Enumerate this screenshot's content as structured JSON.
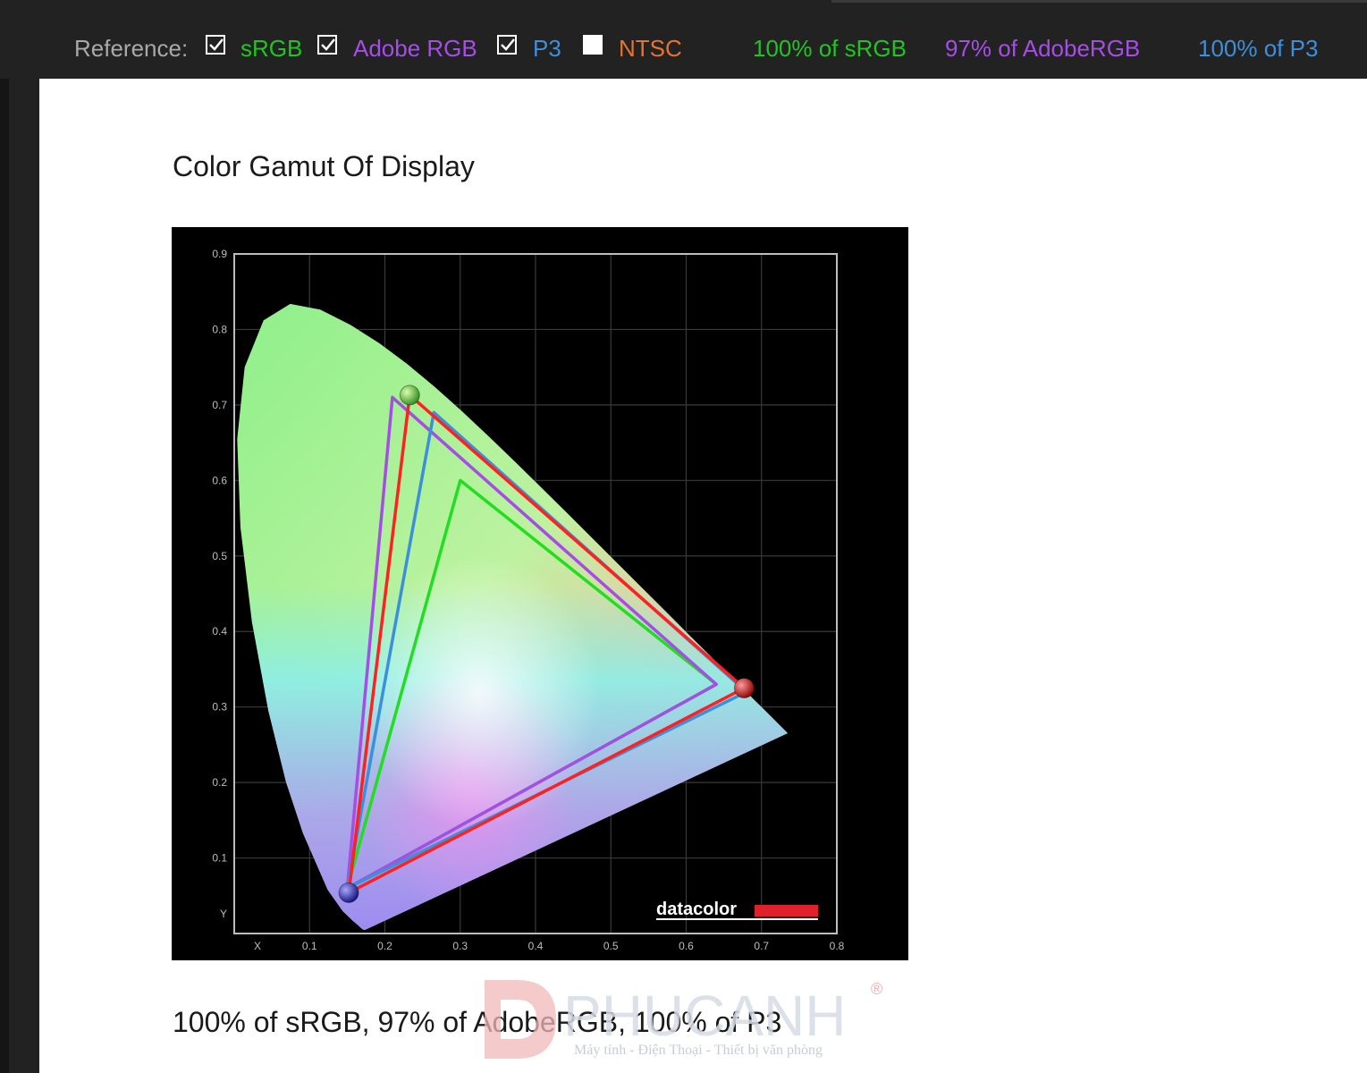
{
  "toolbar": {
    "reference_label": "Reference:",
    "options": [
      {
        "label": "sRGB",
        "checked": true,
        "color": "#22c322"
      },
      {
        "label": "Adobe RGB",
        "checked": true,
        "color": "#a64de6"
      },
      {
        "label": "P3",
        "checked": true,
        "color": "#3d8fdc"
      },
      {
        "label": "NTSC",
        "checked": false,
        "color": "#e8742c"
      }
    ],
    "results": [
      {
        "text": "100% of sRGB",
        "color": "#22c322"
      },
      {
        "text": "97% of AdobeRGB",
        "color": "#a64de6"
      },
      {
        "text": "100% of P3",
        "color": "#3d8fdc"
      }
    ]
  },
  "main": {
    "title": "Color Gamut Of Display",
    "caption": "100% of sRGB, 97% of AdobeRGB, 100% of P3"
  },
  "watermark": {
    "brand": "PHUCANH",
    "tagline": "Máy tính - Điện Thoại - Thiết bị văn phòng",
    "registered": "®"
  },
  "chart_data": {
    "type": "scatter",
    "title": "",
    "xlabel": "X",
    "ylabel": "Y",
    "xlim": [
      0.0,
      0.8
    ],
    "ylim": [
      0.0,
      0.9
    ],
    "x_ticks": [
      "0.1",
      "0.2",
      "0.3",
      "0.4",
      "0.5",
      "0.6",
      "0.7",
      "0.8"
    ],
    "y_ticks": [
      "0.1",
      "0.2",
      "0.3",
      "0.4",
      "0.5",
      "0.6",
      "0.7",
      "0.8",
      "0.9"
    ],
    "grid": true,
    "brand": "datacolor",
    "series": [
      {
        "name": "sRGB",
        "color": "#22dd22",
        "points": [
          [
            0.64,
            0.33
          ],
          [
            0.3,
            0.6
          ],
          [
            0.15,
            0.06
          ]
        ]
      },
      {
        "name": "Adobe RGB",
        "color": "#a64de6",
        "points": [
          [
            0.64,
            0.33
          ],
          [
            0.21,
            0.71
          ],
          [
            0.15,
            0.06
          ]
        ]
      },
      {
        "name": "P3",
        "color": "#3d8fdc",
        "points": [
          [
            0.68,
            0.32
          ],
          [
            0.265,
            0.69
          ],
          [
            0.15,
            0.06
          ]
        ]
      },
      {
        "name": "Display",
        "color": "#ff2020",
        "points": [
          [
            0.677,
            0.325
          ],
          [
            0.233,
            0.713
          ],
          [
            0.152,
            0.054
          ]
        ]
      }
    ],
    "primaries_markers": [
      {
        "color": "green",
        "x": 0.233,
        "y": 0.713
      },
      {
        "color": "red",
        "x": 0.677,
        "y": 0.325
      },
      {
        "color": "blue",
        "x": 0.152,
        "y": 0.054
      }
    ]
  }
}
